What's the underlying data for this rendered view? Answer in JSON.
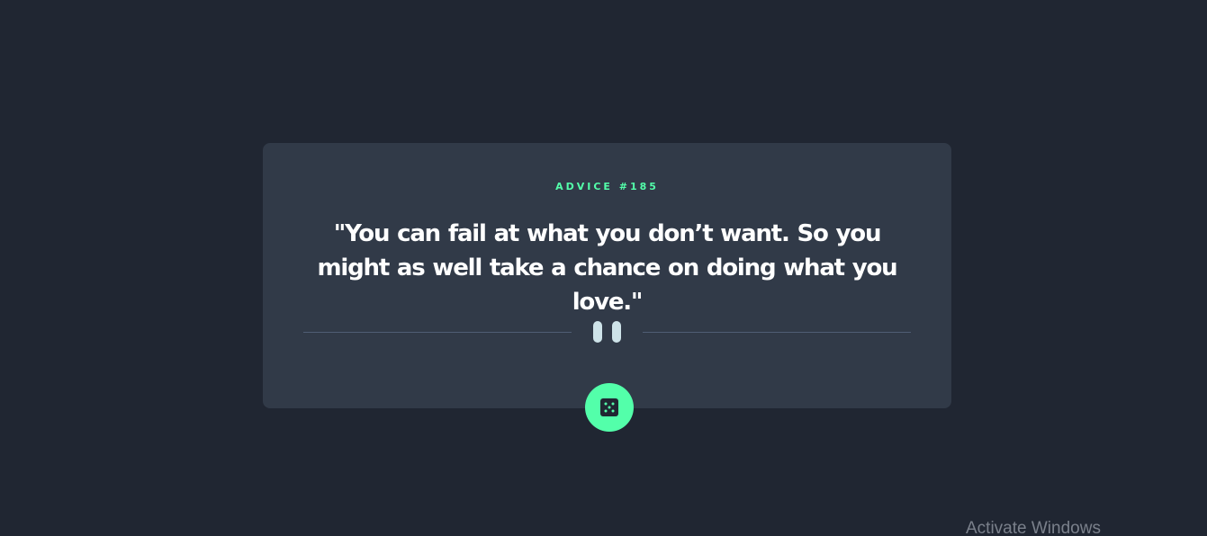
{
  "advice": {
    "id_label": "ADVICE #185",
    "quote": "\"You can fail at what you don’t want. So you might as well take a chance on doing what you love.\""
  },
  "icons": {
    "divider_icon": "pause-icon",
    "button_icon": "dice-icon"
  },
  "colors": {
    "background": "#202632",
    "card": "#313A48",
    "accent": "#53FFAA",
    "text": "#FFFFFF",
    "divider": "#4F5D74",
    "pause": "#CEE3E9"
  },
  "watermark": {
    "text": "Activate Windows"
  }
}
